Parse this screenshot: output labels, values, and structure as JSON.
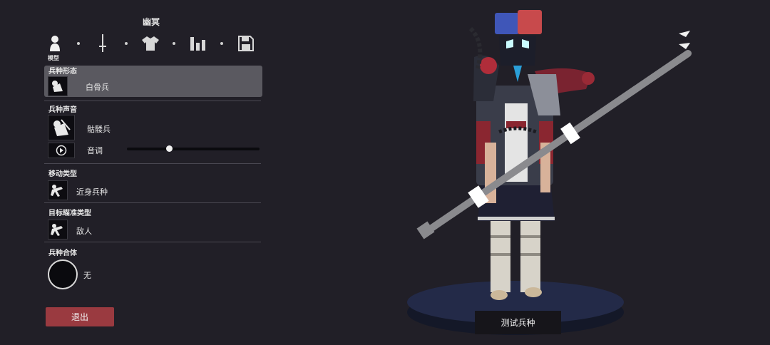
{
  "header": {
    "title": "幽冥"
  },
  "toolbar": {
    "model_label": "模型",
    "icons": [
      "person-icon",
      "sword-icon",
      "shirt-icon",
      "stats-icon",
      "save-icon"
    ]
  },
  "sections": {
    "form": {
      "label": "兵种形态",
      "value": "白骨兵"
    },
    "voice": {
      "label": "兵种声音",
      "value": "骷髅兵",
      "pitch_label": "音调",
      "pitch_level": 0.32
    },
    "movement": {
      "label": "移动类型",
      "value": "近身兵种"
    },
    "targeting": {
      "label": "目标瞄准类型",
      "value": "敌人"
    },
    "merge": {
      "label": "兵种合体",
      "value": "无"
    }
  },
  "buttons": {
    "exit": "退出",
    "test": "测试兵种"
  },
  "colors": {
    "accent_red": "#9a3a40",
    "selected_bg": "#5a5960",
    "background": "#211f27"
  }
}
